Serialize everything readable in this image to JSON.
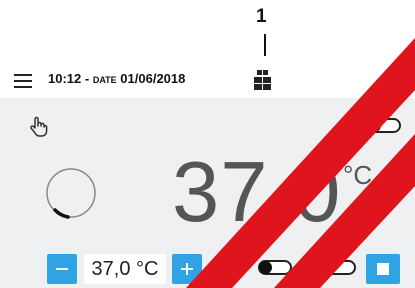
{
  "callout": {
    "number": "1"
  },
  "header": {
    "time": "10:12 -",
    "date_label": "DATE",
    "date": "01/06/2018",
    "icons": {
      "menu": "hamburger-menu-icon",
      "center": "dashboard-grid-icon",
      "settings": "gear-icon"
    }
  },
  "main": {
    "temperature": "37,0",
    "unit": "°C",
    "progress_fraction": 0.12,
    "probe_toggle_on": false
  },
  "footer": {
    "setpoint": "37,0 °C",
    "door_toggle_on": false,
    "lock_toggle_on": false
  },
  "colors": {
    "accent": "#2fa3e3",
    "panel": "#eef0f2",
    "watermark": "#e0141c"
  }
}
